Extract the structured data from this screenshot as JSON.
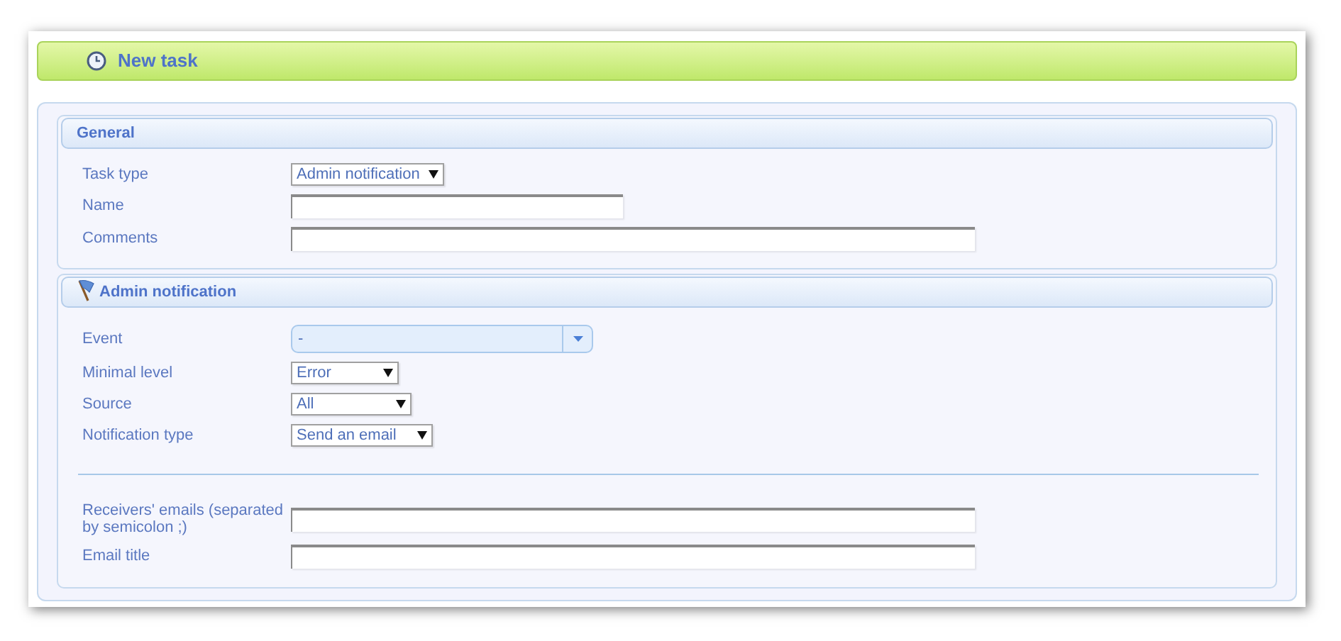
{
  "header": {
    "title": "New task"
  },
  "sections": [
    {
      "title": "General",
      "fields": [
        {
          "kind": "select",
          "label": "Task type",
          "value": "Admin notification"
        },
        {
          "kind": "text",
          "label": "Name"
        },
        {
          "kind": "text",
          "label": "Comments"
        }
      ]
    },
    {
      "title": "Admin notification",
      "fields": [
        {
          "kind": "combo",
          "label": "Event",
          "value": "-"
        },
        {
          "kind": "select",
          "label": "Minimal level",
          "value": "Error"
        },
        {
          "kind": "select",
          "label": "Source",
          "value": "All"
        },
        {
          "kind": "select",
          "label": "Notification type",
          "value": "Send an email"
        },
        {
          "kind": "separator"
        },
        {
          "kind": "text",
          "label": "Receivers' emails (separated by semicolon ;)"
        },
        {
          "kind": "text",
          "label": "Email title"
        }
      ]
    }
  ]
}
